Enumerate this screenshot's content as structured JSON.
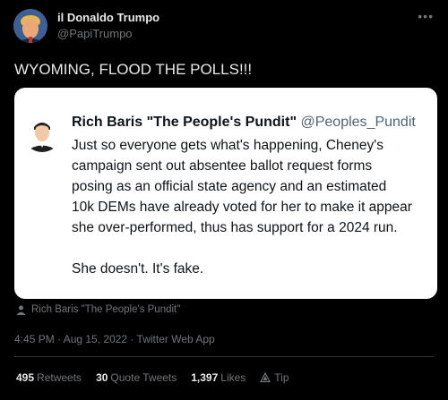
{
  "author": {
    "display_name": "il Donaldo Trumpo",
    "handle": "@PapiTrumpo"
  },
  "tweet": {
    "text": "WYOMING, FLOOD THE POLLS!!!"
  },
  "quoted_tweet": {
    "display_name": "Rich Baris \"The People's Pundit\"",
    "handle": "@Peoples_Pundit",
    "lines": [
      "Just so everyone gets what's happening, Cheney's",
      "campaign sent out absentee ballot request forms",
      "posing as an official state agency and an estimated",
      "10k DEMs have already voted for her to make it appear",
      "she over-performed, thus has support for a 2024 run."
    ],
    "closing": "She doesn't. It's fake."
  },
  "quote_attribution": "Rich Baris \"The People's Pundit\"",
  "meta": {
    "timestamp": "4:45 PM · Aug 15, 2022 · Twitter Web App"
  },
  "stats": {
    "retweets_count": "495",
    "retweets_label": "Retweets",
    "quotes_count": "30",
    "quotes_label": "Quote Tweets",
    "likes_count": "1,397",
    "likes_label": "Likes",
    "tip_label": "Tip"
  },
  "icons": {
    "more": "more-icon",
    "person": "person-icon",
    "tip": "tip-icon"
  },
  "colors": {
    "background": "#000000",
    "text_primary": "#e7e9ea",
    "text_secondary": "#71767b",
    "card_background": "#ffffff",
    "card_text": "#0f1419",
    "card_handle": "#536471"
  }
}
